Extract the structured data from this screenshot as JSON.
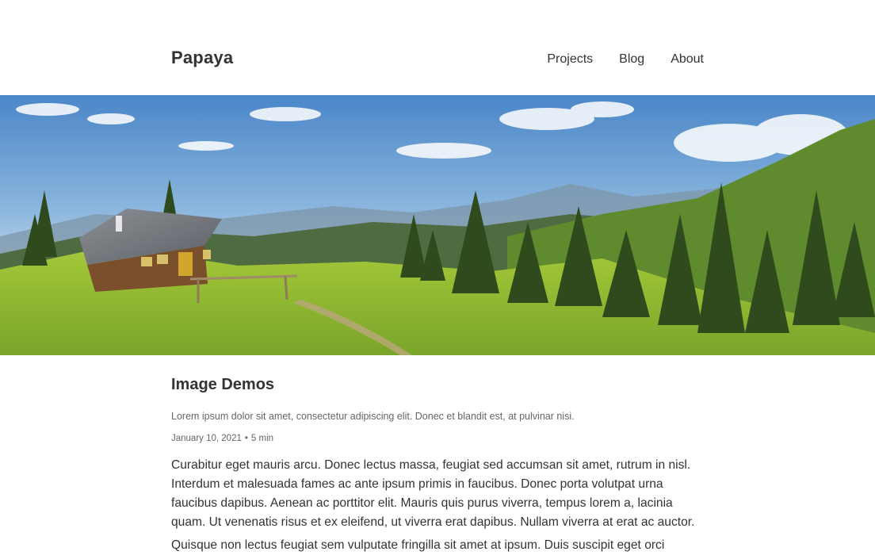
{
  "site": {
    "brand": "Papaya",
    "nav": [
      "Projects",
      "Blog",
      "About"
    ]
  },
  "hero": {
    "icon": "landscape-image"
  },
  "post": {
    "title": "Image Demos",
    "description": "Lorem ipsum dolor sit amet, consectetur adipiscing elit. Donec et blandit est, at pulvinar nisi.",
    "date": "January 10, 2021",
    "separator": "•",
    "read_time": "5 min",
    "paragraphs": [
      "Curabitur eget mauris arcu. Donec lectus massa, feugiat sed accumsan sit amet, rutrum in nisl. Interdum et malesuada fames ac ante ipsum primis in faucibus. Donec porta volutpat urna faucibus dapibus. Aenean ac porttitor elit. Mauris quis purus viverra, tempus lorem a, lacinia quam. Ut venenatis risus et ex eleifend, ut viverra erat dapibus. Nullam viverra at erat ac auctor.",
      "Quisque non lectus feugiat sem vulputate fringilla sit amet at ipsum. Duis suscipit eget orci"
    ]
  },
  "colors": {
    "text": "#333333",
    "muted": "#666666",
    "background": "#ffffff"
  }
}
